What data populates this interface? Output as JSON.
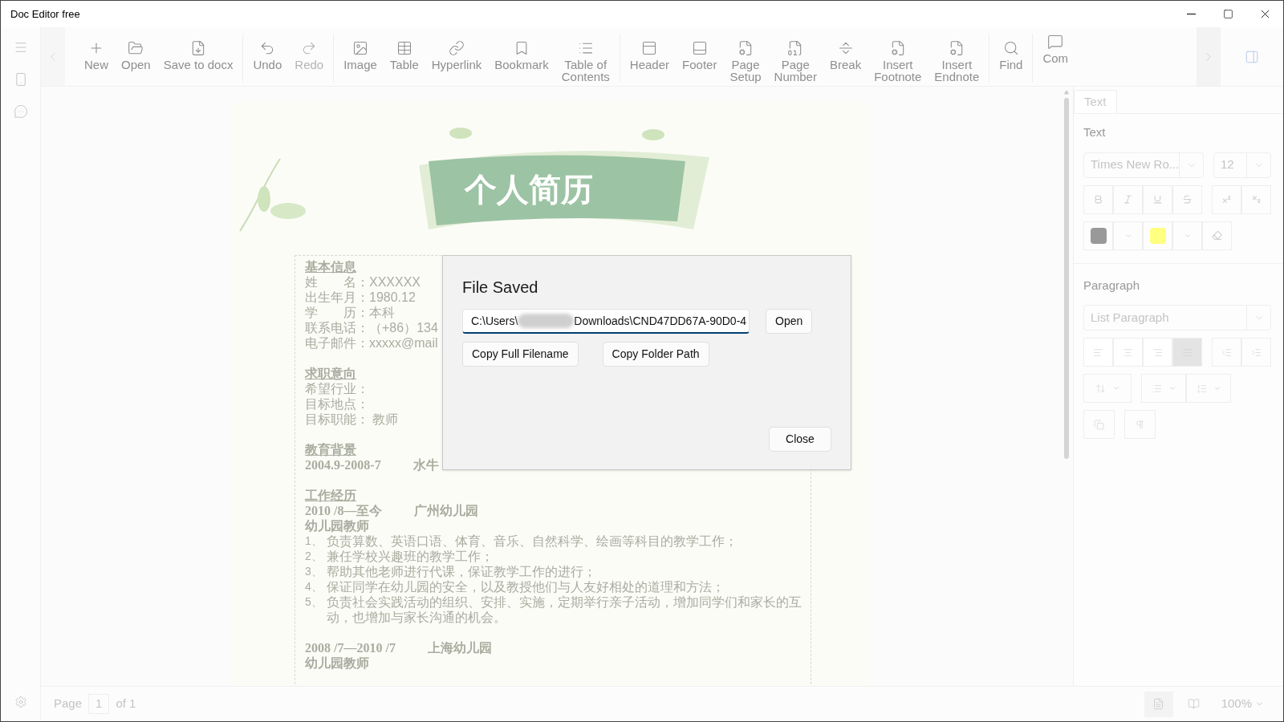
{
  "window": {
    "title": "Doc Editor free"
  },
  "toolbar": {
    "groups": [
      [
        {
          "label": "New",
          "disabled": false
        },
        {
          "label": "Open",
          "disabled": false
        },
        {
          "label": "Save to docx",
          "disabled": false
        }
      ],
      [
        {
          "label": "Undo",
          "disabled": false
        },
        {
          "label": "Redo",
          "disabled": true
        }
      ],
      [
        {
          "label": "Image",
          "disabled": false
        },
        {
          "label": "Table",
          "disabled": false
        },
        {
          "label": "Hyperlink",
          "disabled": false
        },
        {
          "label": "Bookmark",
          "disabled": false
        },
        {
          "label": "Table of\nContents",
          "disabled": false
        }
      ],
      [
        {
          "label": "Header",
          "disabled": false
        },
        {
          "label": "Footer",
          "disabled": false
        },
        {
          "label": "Page\nSetup",
          "disabled": false
        },
        {
          "label": "Page\nNumber",
          "disabled": false
        },
        {
          "label": "Break",
          "disabled": false
        },
        {
          "label": "Insert\nFootnote",
          "disabled": false
        },
        {
          "label": "Insert\nEndnote",
          "disabled": false
        }
      ],
      [
        {
          "label": "Find",
          "disabled": false
        }
      ],
      [
        {
          "label": "Com",
          "disabled": false
        }
      ]
    ]
  },
  "document": {
    "banner_title": "个人简历",
    "sections": [
      {
        "heading": "基本信息",
        "lines": [
          "姓　　名：XXXXXX",
          "出生年月：1980.12",
          "学　　历：本科",
          "联系电话：（+86）134",
          "电子邮件：xxxxx@mail"
        ]
      },
      {
        "heading": "求职意向",
        "lines": [
          "希望行业：",
          "目标地点：",
          "目标职能： 教师"
        ]
      },
      {
        "heading": "教育背景",
        "entries": [
          {
            "date": "2004.9-2008-7",
            "place": "水牛"
          }
        ]
      },
      {
        "heading": "工作经历",
        "entries": [
          {
            "date": "2010 /8—至今",
            "place": "广州幼儿园",
            "role": "幼儿园教师",
            "items": [
              {
                "number": "1、",
                "text": "负责算数、英语口语、体育、音乐、自然科学、绘画等科目的教学工作；"
              },
              {
                "number": "2、",
                "text": "兼任学校兴趣班的教学工作；"
              },
              {
                "number": "3、",
                "text": "帮助其他老师进行代课，保证教学工作的进行；"
              },
              {
                "number": "4、",
                "text": "保证同学在幼儿园的安全，以及教授他们与人友好相处的道理和方法；"
              },
              {
                "number": "5、",
                "text": "负责社会实践活动的组织、安排、实施，定期举行亲子活动，增加同学们和家长的互动，也增加与家长沟通的机会。"
              }
            ]
          },
          {
            "date": "2008 /7—2010 /7",
            "place": "上海幼儿园",
            "role": "幼儿园教师"
          }
        ]
      }
    ]
  },
  "panel": {
    "tabs": [
      {
        "label": "Text",
        "selected": true
      }
    ],
    "text_section": {
      "title": "Text",
      "font": "Times New Ro...",
      "size": "12",
      "swatches": [
        {
          "color": "#999999"
        },
        {
          "color": "#ffff80"
        }
      ]
    },
    "paragraph_section": {
      "title": "Paragraph",
      "style": "List Paragraph",
      "alignments": [
        {
          "selected": false
        },
        {
          "selected": false
        },
        {
          "selected": false
        },
        {
          "selected": true
        }
      ]
    }
  },
  "status_bar": {
    "page_label": "Page",
    "page": "1",
    "of_label": "of 1",
    "zoom": "100%"
  },
  "dialog": {
    "title": "File Saved",
    "path_start": "C:\\Users\\",
    "path_end": "Downloads\\CND47DD67A-90D0-4",
    "open_button": "Open",
    "copy_filename_button": "Copy Full Filename",
    "copy_folder_button": "Copy Folder Path",
    "close_button": "Close"
  }
}
